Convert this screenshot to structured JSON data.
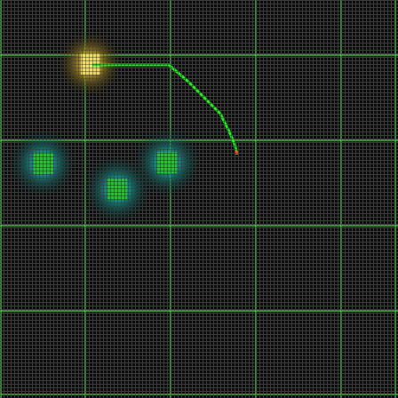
{
  "game": {
    "grid": {
      "major_line_color": "#5fe05f",
      "minor_line_color": "#a5a5a5",
      "background": "#0b0b0b"
    },
    "nodes": [
      {
        "kind": "goal",
        "color": "#f2e24a",
        "glow": "#b89a1e"
      },
      {
        "kind": "target",
        "color": "#2fd12f",
        "glow": "#1aa0a0"
      },
      {
        "kind": "target",
        "color": "#2fd12f",
        "glow": "#1aa0a0"
      },
      {
        "kind": "target",
        "color": "#2fd12f",
        "glow": "#1aa0a0"
      }
    ],
    "path": {
      "color": "#22ee22",
      "head_color": "#e0562a"
    }
  }
}
